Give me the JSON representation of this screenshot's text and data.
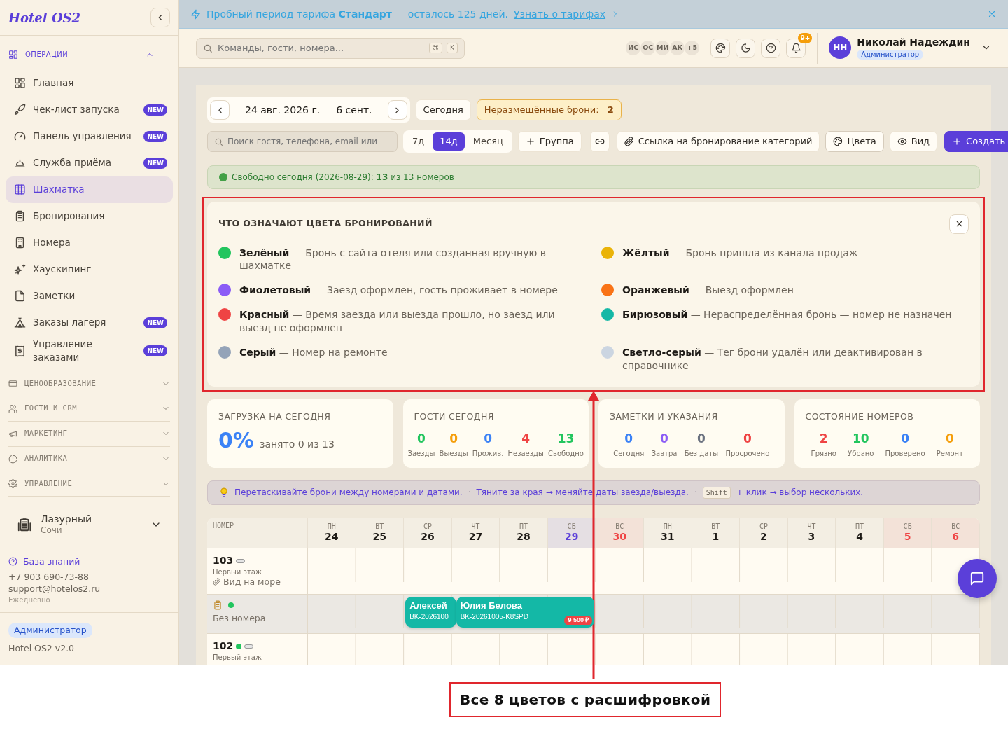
{
  "sidebar": {
    "logo": "Hotel OS2",
    "sections": [
      {
        "label": "ОПЕРАЦИИ",
        "expanded": true,
        "items": [
          {
            "label": "Главная",
            "selected": false
          },
          {
            "label": "Чек-лист запуска",
            "badge": "NEW",
            "selected": false
          },
          {
            "label": "Панель управления",
            "badge": "NEW",
            "selected": false
          },
          {
            "label": "Служба приёма",
            "badge": "NEW",
            "selected": false
          },
          {
            "label": "Шахматка",
            "selected": true
          },
          {
            "label": "Бронирования",
            "selected": false
          },
          {
            "label": "Номера",
            "selected": false
          },
          {
            "label": "Хаускипинг",
            "selected": false
          },
          {
            "label": "Заметки",
            "selected": false
          },
          {
            "label": "Заказы лагеря",
            "badge": "NEW",
            "selected": false
          },
          {
            "label": "Управление заказами",
            "badge": "NEW",
            "selected": false
          }
        ]
      },
      {
        "label": "ЦЕНООБРАЗОВАНИЕ",
        "expanded": false
      },
      {
        "label": "ГОСТИ И CRM",
        "expanded": false
      },
      {
        "label": "МАРКЕТИНГ",
        "expanded": false
      },
      {
        "label": "АНАЛИТИКА",
        "expanded": false
      },
      {
        "label": "УПРАВЛЕНИЕ",
        "expanded": false
      }
    ],
    "property": {
      "name": "Лазурный",
      "city": "Сочи"
    },
    "support": {
      "link": "База знаний",
      "phone": "+7 903 690-73-88",
      "email": "support@hotelos2.ru",
      "hours": "Ежедневно"
    },
    "role": "Администратор",
    "version": "Hotel OS2 v2.0"
  },
  "banner": {
    "text": "Пробный период тарифа **Стандарт** — осталось 125 дней.",
    "link": "Узнать о тарифах"
  },
  "header": {
    "search": {
      "placeholder": "Команды, гости, номера...",
      "keys": [
        "⌘",
        "K"
      ]
    },
    "avatars": [
      "ИС",
      "ОС",
      "МИ",
      "АК",
      "+5"
    ],
    "notifications": "9+",
    "user": {
      "initials": "НН",
      "name": "Николай Надеждин",
      "role": "Администратор"
    }
  },
  "toolbar": {
    "date_range": "24 авг. 2026 г. — 6 сент.",
    "today": "Сегодня",
    "unplaced": {
      "label": "Неразмещённые брони:",
      "count": "2"
    },
    "search": {
      "placeholder": "Поиск гостя, телефона, email или"
    },
    "ranges": [
      {
        "label": "7д",
        "selected": false
      },
      {
        "label": "14д",
        "selected": true
      },
      {
        "label": "Месяц",
        "selected": false
      }
    ],
    "buttons": [
      {
        "kind": "group",
        "label": "Группа"
      },
      {
        "kind": "link"
      },
      {
        "kind": "booking_link",
        "label": "Ссылка на бронирование категорий"
      },
      {
        "kind": "colors",
        "label": "Цвета"
      },
      {
        "kind": "view",
        "label": "Вид"
      },
      {
        "kind": "create",
        "label": "Создать"
      }
    ]
  },
  "availability": "Свободно сегодня (2026-08-29): **13** из 13 номеров",
  "legend": {
    "title": "ЧТО ОЗНАЧАЮТ ЦВЕТА БРОНИРОВАНИЙ",
    "items": [
      {
        "color": "#22c55e",
        "text": "**Зелёный** — Бронь с сайта отеля или созданная вручную в шахматке"
      },
      {
        "color": "#eab308",
        "text": "**Жёлтый** — Бронь пришла из канала продаж"
      },
      {
        "color": "#8b5cf6",
        "text": "**Фиолетовый** — Заезд оформлен, гость проживает в номере"
      },
      {
        "color": "#f97316",
        "text": "**Оранжевый** — Выезд оформлен"
      },
      {
        "color": "#ef4444",
        "text": "**Красный** — Время заезда или выезда прошло, но заезд или выезд не оформлен"
      },
      {
        "color": "#14b8a6",
        "text": "**Бирюзовый** — Нераспределённая бронь — номер не назначен"
      },
      {
        "color": "#94a3b8",
        "text": "**Серый** — Номер на ремонте"
      },
      {
        "color": "#cbd5e1",
        "text": "**Светло-серый** — Тег брони удалён или деактивирован в справочнике"
      }
    ]
  },
  "stats": [
    {
      "kind": "big",
      "title": "ЗАГРУЗКА НА СЕГОДНЯ",
      "value": "0%",
      "note": "занято 0 из 13"
    },
    {
      "kind": "counts",
      "title": "ГОСТИ СЕГОДНЯ",
      "counts": [
        {
          "value": "0",
          "label": "Заезды",
          "color": "#22c55e"
        },
        {
          "value": "0",
          "label": "Выезды",
          "color": "#f59e0b"
        },
        {
          "value": "0",
          "label": "Прожив.",
          "color": "#3b82f6"
        },
        {
          "value": "4",
          "label": "Незаезды",
          "color": "#ef4444"
        },
        {
          "value": "13",
          "label": "Свободно",
          "color": "#22c55e"
        }
      ]
    },
    {
      "kind": "counts",
      "title": "ЗАМЕТКИ И УКАЗАНИЯ",
      "counts": [
        {
          "value": "0",
          "label": "Сегодня",
          "color": "#3b82f6"
        },
        {
          "value": "0",
          "label": "Завтра",
          "color": "#8b5cf6"
        },
        {
          "value": "0",
          "label": "Без даты",
          "color": "#6b7280"
        },
        {
          "value": "0",
          "label": "Просрочено",
          "color": "#ef4444"
        }
      ]
    },
    {
      "kind": "counts",
      "title": "СОСТОЯНИЕ НОМЕРОВ",
      "counts": [
        {
          "value": "2",
          "label": "Грязно",
          "color": "#ef4444"
        },
        {
          "value": "10",
          "label": "Убрано",
          "color": "#22c55e"
        },
        {
          "value": "0",
          "label": "Проверено",
          "color": "#3b82f6"
        },
        {
          "value": "0",
          "label": "Ремонт",
          "color": "#f59e0b"
        }
      ]
    }
  ],
  "hint": {
    "drag": "Перетаскивайте брони между номерами и датами.",
    "separator": "·",
    "resize": "Тяните за края → меняйте даты заезда/выезда.",
    "key": "Shift",
    "select": "+ клик → выбор нескольких."
  },
  "calendar": {
    "room_header": "НОМЕР",
    "days": [
      {
        "dow": "ПН",
        "day": "24",
        "kind": "day"
      },
      {
        "dow": "ВТ",
        "day": "25",
        "kind": "day"
      },
      {
        "dow": "СР",
        "day": "26",
        "kind": "day"
      },
      {
        "dow": "ЧТ",
        "day": "27",
        "kind": "day"
      },
      {
        "dow": "ПТ",
        "day": "28",
        "kind": "day"
      },
      {
        "dow": "СБ",
        "day": "29",
        "kind": "today"
      },
      {
        "dow": "ВС",
        "day": "30",
        "kind": "weekend"
      },
      {
        "dow": "ПН",
        "day": "31",
        "kind": "day"
      },
      {
        "dow": "ВТ",
        "day": "1",
        "kind": "day"
      },
      {
        "dow": "СР",
        "day": "2",
        "kind": "day"
      },
      {
        "dow": "ЧТ",
        "day": "3",
        "kind": "day"
      },
      {
        "dow": "ПТ",
        "day": "4",
        "kind": "day"
      },
      {
        "dow": "СБ",
        "day": "5",
        "kind": "weekend"
      },
      {
        "dow": "ВС",
        "day": "6",
        "kind": "weekend"
      }
    ],
    "rows": [
      {
        "kind": "room",
        "number": "103",
        "floor": "Первый этаж",
        "note": "Вид на море"
      },
      {
        "kind": "unassigned",
        "label": "Без номера",
        "color": "#22c55e",
        "bookings": [
          {
            "guest": "Алексей",
            "code": "BK-2026100"
          },
          {
            "guest": "Юлия Белова",
            "code": "BK-20261005-K8SPD",
            "price": "9 500 ₽"
          }
        ]
      },
      {
        "kind": "room",
        "number": "102",
        "floor": "Первый этаж",
        "color": "#22c55e"
      }
    ]
  },
  "annotation": "Все 8 цветов с расшифровкой"
}
